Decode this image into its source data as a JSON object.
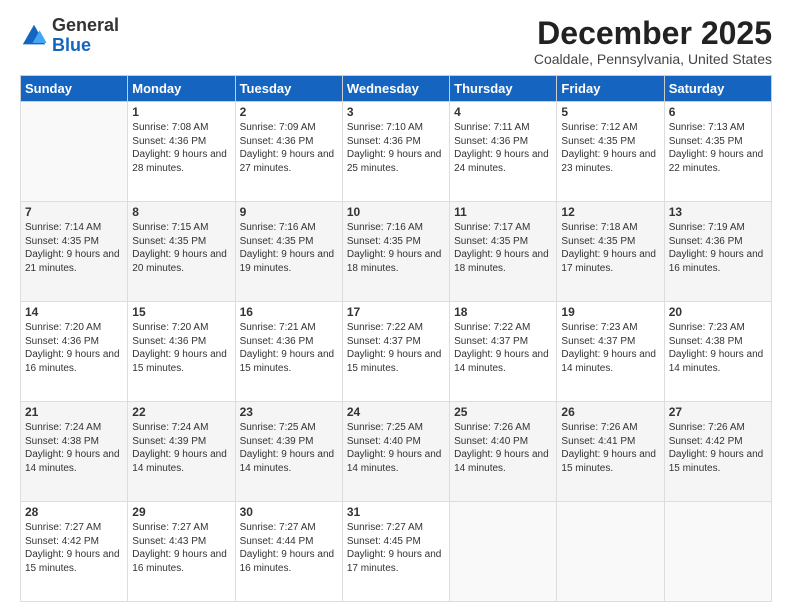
{
  "logo": {
    "general": "General",
    "blue": "Blue"
  },
  "title": "December 2025",
  "location": "Coaldale, Pennsylvania, United States",
  "weekdays": [
    "Sunday",
    "Monday",
    "Tuesday",
    "Wednesday",
    "Thursday",
    "Friday",
    "Saturday"
  ],
  "weeks": [
    [
      {
        "day": "",
        "sunrise": "",
        "sunset": "",
        "daylight": ""
      },
      {
        "day": "1",
        "sunrise": "Sunrise: 7:08 AM",
        "sunset": "Sunset: 4:36 PM",
        "daylight": "Daylight: 9 hours and 28 minutes."
      },
      {
        "day": "2",
        "sunrise": "Sunrise: 7:09 AM",
        "sunset": "Sunset: 4:36 PM",
        "daylight": "Daylight: 9 hours and 27 minutes."
      },
      {
        "day": "3",
        "sunrise": "Sunrise: 7:10 AM",
        "sunset": "Sunset: 4:36 PM",
        "daylight": "Daylight: 9 hours and 25 minutes."
      },
      {
        "day": "4",
        "sunrise": "Sunrise: 7:11 AM",
        "sunset": "Sunset: 4:36 PM",
        "daylight": "Daylight: 9 hours and 24 minutes."
      },
      {
        "day": "5",
        "sunrise": "Sunrise: 7:12 AM",
        "sunset": "Sunset: 4:35 PM",
        "daylight": "Daylight: 9 hours and 23 minutes."
      },
      {
        "day": "6",
        "sunrise": "Sunrise: 7:13 AM",
        "sunset": "Sunset: 4:35 PM",
        "daylight": "Daylight: 9 hours and 22 minutes."
      }
    ],
    [
      {
        "day": "7",
        "sunrise": "Sunrise: 7:14 AM",
        "sunset": "Sunset: 4:35 PM",
        "daylight": "Daylight: 9 hours and 21 minutes."
      },
      {
        "day": "8",
        "sunrise": "Sunrise: 7:15 AM",
        "sunset": "Sunset: 4:35 PM",
        "daylight": "Daylight: 9 hours and 20 minutes."
      },
      {
        "day": "9",
        "sunrise": "Sunrise: 7:16 AM",
        "sunset": "Sunset: 4:35 PM",
        "daylight": "Daylight: 9 hours and 19 minutes."
      },
      {
        "day": "10",
        "sunrise": "Sunrise: 7:16 AM",
        "sunset": "Sunset: 4:35 PM",
        "daylight": "Daylight: 9 hours and 18 minutes."
      },
      {
        "day": "11",
        "sunrise": "Sunrise: 7:17 AM",
        "sunset": "Sunset: 4:35 PM",
        "daylight": "Daylight: 9 hours and 18 minutes."
      },
      {
        "day": "12",
        "sunrise": "Sunrise: 7:18 AM",
        "sunset": "Sunset: 4:35 PM",
        "daylight": "Daylight: 9 hours and 17 minutes."
      },
      {
        "day": "13",
        "sunrise": "Sunrise: 7:19 AM",
        "sunset": "Sunset: 4:36 PM",
        "daylight": "Daylight: 9 hours and 16 minutes."
      }
    ],
    [
      {
        "day": "14",
        "sunrise": "Sunrise: 7:20 AM",
        "sunset": "Sunset: 4:36 PM",
        "daylight": "Daylight: 9 hours and 16 minutes."
      },
      {
        "day": "15",
        "sunrise": "Sunrise: 7:20 AM",
        "sunset": "Sunset: 4:36 PM",
        "daylight": "Daylight: 9 hours and 15 minutes."
      },
      {
        "day": "16",
        "sunrise": "Sunrise: 7:21 AM",
        "sunset": "Sunset: 4:36 PM",
        "daylight": "Daylight: 9 hours and 15 minutes."
      },
      {
        "day": "17",
        "sunrise": "Sunrise: 7:22 AM",
        "sunset": "Sunset: 4:37 PM",
        "daylight": "Daylight: 9 hours and 15 minutes."
      },
      {
        "day": "18",
        "sunrise": "Sunrise: 7:22 AM",
        "sunset": "Sunset: 4:37 PM",
        "daylight": "Daylight: 9 hours and 14 minutes."
      },
      {
        "day": "19",
        "sunrise": "Sunrise: 7:23 AM",
        "sunset": "Sunset: 4:37 PM",
        "daylight": "Daylight: 9 hours and 14 minutes."
      },
      {
        "day": "20",
        "sunrise": "Sunrise: 7:23 AM",
        "sunset": "Sunset: 4:38 PM",
        "daylight": "Daylight: 9 hours and 14 minutes."
      }
    ],
    [
      {
        "day": "21",
        "sunrise": "Sunrise: 7:24 AM",
        "sunset": "Sunset: 4:38 PM",
        "daylight": "Daylight: 9 hours and 14 minutes."
      },
      {
        "day": "22",
        "sunrise": "Sunrise: 7:24 AM",
        "sunset": "Sunset: 4:39 PM",
        "daylight": "Daylight: 9 hours and 14 minutes."
      },
      {
        "day": "23",
        "sunrise": "Sunrise: 7:25 AM",
        "sunset": "Sunset: 4:39 PM",
        "daylight": "Daylight: 9 hours and 14 minutes."
      },
      {
        "day": "24",
        "sunrise": "Sunrise: 7:25 AM",
        "sunset": "Sunset: 4:40 PM",
        "daylight": "Daylight: 9 hours and 14 minutes."
      },
      {
        "day": "25",
        "sunrise": "Sunrise: 7:26 AM",
        "sunset": "Sunset: 4:40 PM",
        "daylight": "Daylight: 9 hours and 14 minutes."
      },
      {
        "day": "26",
        "sunrise": "Sunrise: 7:26 AM",
        "sunset": "Sunset: 4:41 PM",
        "daylight": "Daylight: 9 hours and 15 minutes."
      },
      {
        "day": "27",
        "sunrise": "Sunrise: 7:26 AM",
        "sunset": "Sunset: 4:42 PM",
        "daylight": "Daylight: 9 hours and 15 minutes."
      }
    ],
    [
      {
        "day": "28",
        "sunrise": "Sunrise: 7:27 AM",
        "sunset": "Sunset: 4:42 PM",
        "daylight": "Daylight: 9 hours and 15 minutes."
      },
      {
        "day": "29",
        "sunrise": "Sunrise: 7:27 AM",
        "sunset": "Sunset: 4:43 PM",
        "daylight": "Daylight: 9 hours and 16 minutes."
      },
      {
        "day": "30",
        "sunrise": "Sunrise: 7:27 AM",
        "sunset": "Sunset: 4:44 PM",
        "daylight": "Daylight: 9 hours and 16 minutes."
      },
      {
        "day": "31",
        "sunrise": "Sunrise: 7:27 AM",
        "sunset": "Sunset: 4:45 PM",
        "daylight": "Daylight: 9 hours and 17 minutes."
      },
      {
        "day": "",
        "sunrise": "",
        "sunset": "",
        "daylight": ""
      },
      {
        "day": "",
        "sunrise": "",
        "sunset": "",
        "daylight": ""
      },
      {
        "day": "",
        "sunrise": "",
        "sunset": "",
        "daylight": ""
      }
    ]
  ]
}
